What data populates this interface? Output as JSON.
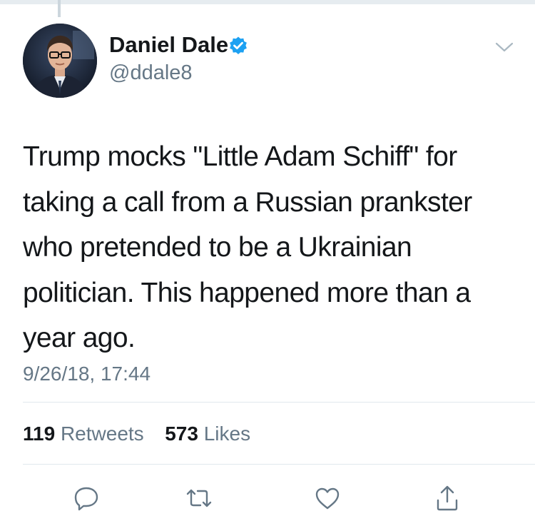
{
  "author": {
    "display_name": "Daniel Dale",
    "handle": "@ddale8",
    "verified": true
  },
  "tweet": {
    "text_lines": [
      "Trump mocks \"Little Adam Schiff\" for",
      "taking a call from a Russian prankster",
      "who pretended to be a Ukrainian",
      "politician. This happened more than a",
      "year ago."
    ],
    "timestamp": "9/26/18, 17:44"
  },
  "stats": {
    "retweets_count": "119",
    "retweets_label": "Retweets",
    "likes_count": "573",
    "likes_label": "Likes"
  },
  "actions": [
    {
      "name": "reply",
      "icon": "speech-bubble-icon"
    },
    {
      "name": "retweet",
      "icon": "retweet-arrows-icon"
    },
    {
      "name": "like",
      "icon": "heart-icon"
    },
    {
      "name": "share",
      "icon": "share-upload-icon"
    }
  ],
  "colors": {
    "text_primary": "#14171a",
    "text_secondary": "#657786",
    "verified_blue": "#1da1f2",
    "divider": "#e1e8ed",
    "action_icon": "#657786"
  }
}
